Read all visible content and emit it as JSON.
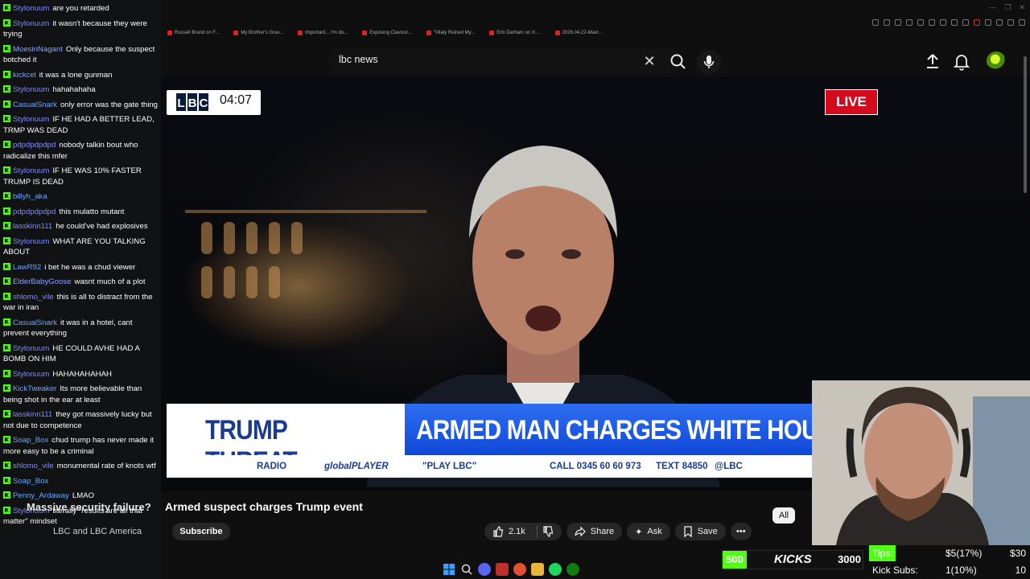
{
  "chat": {
    "messages": [
      {
        "user": "Stylonuum",
        "text": "are you retarded",
        "color": "c2"
      },
      {
        "user": "Stylonuum",
        "text": "it wasn't because they were trying",
        "color": "c2"
      },
      {
        "user": "MoesinNagant",
        "text": "Only because the suspect botched it",
        "color": "c3"
      },
      {
        "user": "kickcel",
        "text": "it was a lone gunman",
        "color": "c1"
      },
      {
        "user": "Stylonuum",
        "text": "hahahahaha",
        "color": "c2"
      },
      {
        "user": "CasualSnark",
        "text": "only error was the gate thing",
        "color": "c1"
      },
      {
        "user": "Stylonuum",
        "text": "IF HE HAD A BETTER LEAD, TRMP WAS DEAD",
        "color": "c2"
      },
      {
        "user": "pdpdpdpdpd",
        "text": "nobody talkin bout who radicalize this mfer",
        "color": "c2"
      },
      {
        "user": "Stylonuum",
        "text": "IF HE WAS 10% FASTER TRUMP IS DEAD",
        "color": "c2"
      },
      {
        "user": "billyh_aka",
        "text": "",
        "color": "c1"
      },
      {
        "user": "pdpdpdpdpd",
        "text": "this mulatto mutant",
        "color": "c2"
      },
      {
        "user": "lasskinn111",
        "text": "he could've had explosives",
        "color": "c2"
      },
      {
        "user": "Stylonuum",
        "text": "WHAT ARE YOU TALKING ABOUT",
        "color": "c2"
      },
      {
        "user": "LawR92",
        "text": "i bet he was a chud viewer",
        "color": "c1"
      },
      {
        "user": "ElderBabyGoose",
        "text": "wasnt much of a plot",
        "color": "c3"
      },
      {
        "user": "shlomo_vile",
        "text": "this is all to distract from the war in iran",
        "color": "c2"
      },
      {
        "user": "CasualSnark",
        "text": "it was in a hotel, cant prevent everything",
        "color": "c1"
      },
      {
        "user": "Stylonuum",
        "text": "HE COULD AVHE HAD A BOMB ON HIM",
        "color": "c2"
      },
      {
        "user": "Stylonuum",
        "text": "HAHAHAHAHAH",
        "color": "c2"
      },
      {
        "user": "KickTweaker",
        "text": "Its more believable than being shot in the ear at least",
        "color": "c1"
      },
      {
        "user": "lasskinn111",
        "text": "they got massively lucky but not due to competence",
        "color": "c2"
      },
      {
        "user": "Soap_Box",
        "text": "chud trump has never made it more easy to be a criminal",
        "color": "c1"
      },
      {
        "user": "shlomo_vile",
        "text": "monumental rate of knots wtf",
        "color": "c2"
      },
      {
        "user": "Soap_Box",
        "text": "",
        "color": "c1"
      },
      {
        "user": "Penny_Ardaway",
        "text": "LMAO",
        "color": "c1"
      },
      {
        "user": "Stylonuum",
        "text": "literally \"results are all that matter\" mindset",
        "color": "c2"
      }
    ]
  },
  "browser": {
    "bookmarks": [
      "Russell Brand on F...",
      "My Brother's Grav...",
      "Important... I'm do...",
      "Exposing Clavicul...",
      "\"Vitaly Ruined My...",
      "Erin Derham on X:...",
      "2026.04.22-Mavr..."
    ]
  },
  "search": {
    "value": "lbc news"
  },
  "video": {
    "clock": "04:07",
    "logo": "LBC",
    "live": "LIVE",
    "headline_left": "TRUMP THREAT",
    "headline_right": "ARMED MAN CHARGES WHITE HOUSE DI",
    "ticker": {
      "radio": "RADIO",
      "globalplayer": "globalPLAYER",
      "play": "\"PLAY LBC\"",
      "call": "CALL 0345 60 60 973",
      "text": "TEXT 84850",
      "handle": "@LBC"
    }
  },
  "below": {
    "title": "Armed suspect charges Trump event",
    "overlay_question": "Massive security failure?",
    "channel": "LBC and LBC America",
    "subscribe": "Subscribe",
    "likes": "2.1k",
    "share": "Share",
    "ask": "Ask",
    "save": "Save",
    "filter_all": "All"
  },
  "kicks": {
    "start": "500",
    "label": "KICKS",
    "goal": "3000"
  },
  "stats": [
    {
      "key": "Tips:",
      "value": "$5(17%)",
      "target": "$30"
    },
    {
      "key": "Kick Subs:",
      "value": "1(10%)",
      "target": "10"
    }
  ],
  "colors": {
    "kick_green": "#53fc18",
    "live_red": "#d40a1d",
    "lbc_blue": "#1a3b8f"
  }
}
